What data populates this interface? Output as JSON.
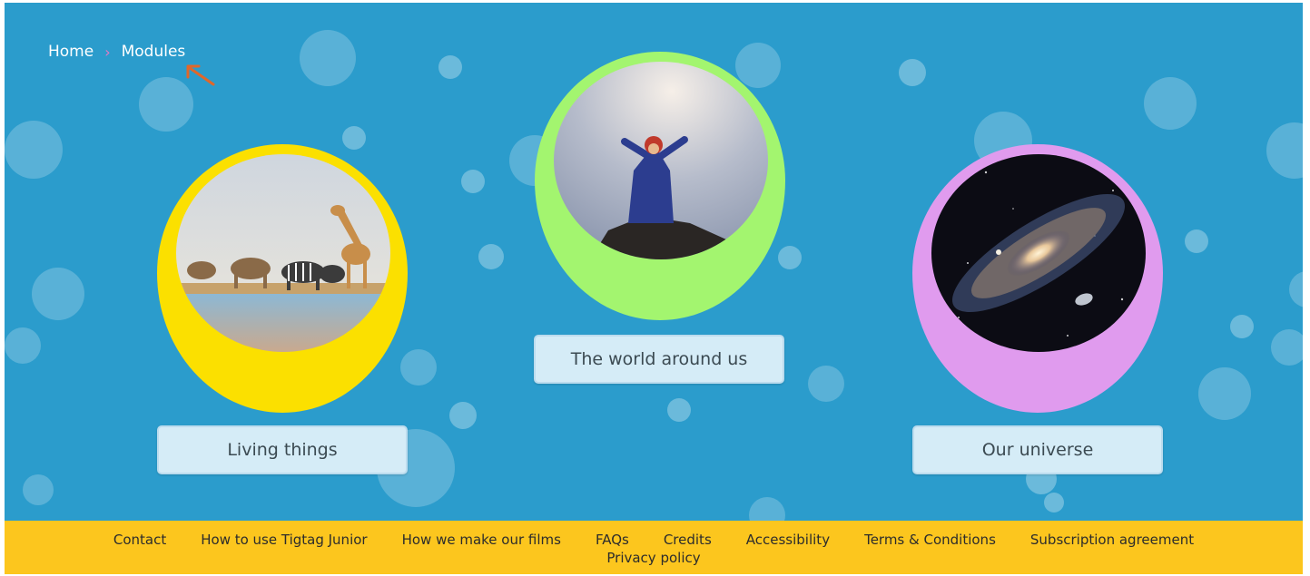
{
  "breadcrumb": {
    "home": "Home",
    "current": "Modules"
  },
  "modules": [
    {
      "label": "Living things",
      "ring_color": "#fbe000"
    },
    {
      "label": "The world around us",
      "ring_color": "#a3f56f"
    },
    {
      "label": "Our universe",
      "ring_color": "#e09bee"
    }
  ],
  "footer": {
    "links": [
      "Contact",
      "How to use Tigtag Junior",
      "How we make our films",
      "FAQs",
      "Credits",
      "Accessibility",
      "Terms & Conditions",
      "Subscription agreement"
    ],
    "privacy": "Privacy policy"
  },
  "colors": {
    "background": "#2b9ccc",
    "footer": "#fcc61e",
    "breadcrumb_separator": "#e879c4",
    "annotation_arrow": "#e0672a"
  }
}
